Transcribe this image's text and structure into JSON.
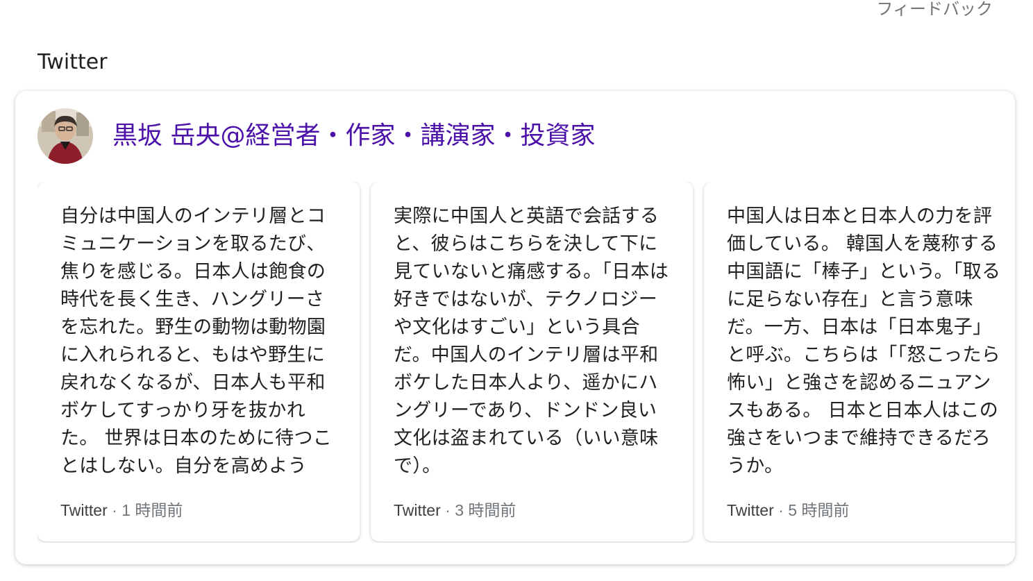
{
  "feedback_label": "フィードバック",
  "section_title": "Twitter",
  "account": {
    "name": "黒坂 岳央@経営者・作家・講演家・投資家"
  },
  "tweets": [
    {
      "text": "自分は中国人のインテリ層とコミュニケーションを取るたび、焦りを感じる。日本人は飽食の時代を長く生き、ハングリーさを忘れた。野生の動物は動物園に入れられると、もはや野生に戻れなくなるが、日本人も平和ボケしてすっかり牙を抜かれた。 世界は日本のために待つことはしない。自分を高めよう",
      "source": "Twitter",
      "separator": " · ",
      "time": "1 時間前"
    },
    {
      "text": "実際に中国人と英語で会話すると、彼らはこちらを決して下に見ていないと痛感する。「日本は好きではないが、テクノロジーや文化はすごい」という具合だ。中国人のインテリ層は平和ボケした日本人より、遥かにハングリーであり、ドンドン良い文化は盗まれている（いい意味で）。",
      "source": "Twitter",
      "separator": " · ",
      "time": "3 時間前"
    },
    {
      "text": "中国人は日本と日本人の力を評価している。 韓国人を蔑称する中国語に「棒子」という。「取るに足らない存在」と言う意味だ。一方、日本は「日本鬼子」と呼ぶ。こちらは「「怒こったら怖い」と強さを認めるニュアンスもある。 日本と日本人はこの強さをいつまで維持できるだろうか。",
      "source": "Twitter",
      "separator": " · ",
      "time": "5 時間前"
    }
  ],
  "colors": {
    "account_link": "#4b11a8",
    "secondary_text": "#70757a",
    "primary_text": "#202124"
  }
}
